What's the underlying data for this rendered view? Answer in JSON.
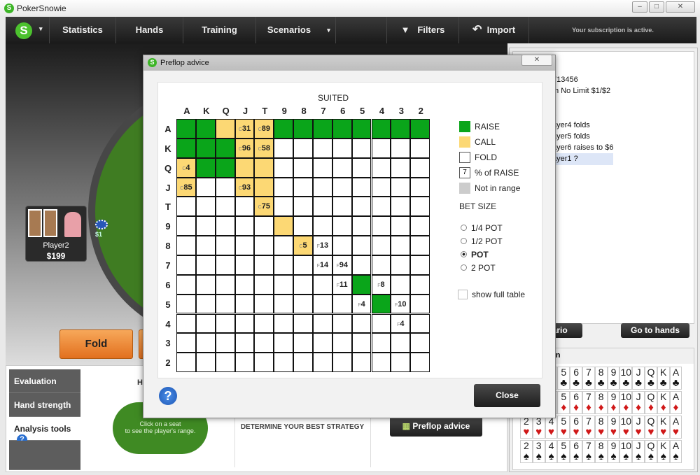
{
  "window": {
    "title": "PokerSnowie",
    "logo": "S"
  },
  "nav": {
    "items": [
      "Statistics",
      "Hands",
      "Training",
      "Scenarios"
    ],
    "filters": "Filters",
    "import": "Import",
    "subscription": "Your subscription is active."
  },
  "table": {
    "player": {
      "name": "Player2",
      "stack": "$199"
    },
    "bet": "$1",
    "fold_label": "Fold"
  },
  "bottom": {
    "tabs": [
      "Evaluation",
      "Hand strength",
      "Analysis tools"
    ],
    "seat_hint_1": "Click on a seat",
    "seat_hint_2": "to see the player's range.",
    "strategy_text": "DETERMINE YOUR BEST STRATEGY",
    "preflop_button": "Preflop advice",
    "hidden_title_fragment": "H"
  },
  "history": {
    "lines": [
      "713456",
      "m No Limit $1/$2",
      "",
      "s",
      "ayer4 folds",
      "ayer5 folds",
      "ayer6 raises to $6",
      "ayer1 ?"
    ],
    "scenario_btn": "nario",
    "goto_btn": "Go to hands",
    "section_title": "on"
  },
  "cards": {
    "ranks": [
      "2",
      "3",
      "4",
      "5",
      "6",
      "7",
      "8",
      "9",
      "10",
      "J",
      "Q",
      "K",
      "A"
    ],
    "suits": [
      {
        "s": "♣",
        "c": "#111"
      },
      {
        "s": "♦",
        "c": "#d01818"
      },
      {
        "s": "♥",
        "c": "#d01818"
      },
      {
        "s": "♠",
        "c": "#111"
      }
    ]
  },
  "dialog": {
    "title": "Preflop advice",
    "suited_label": "SUITED",
    "close": "Close",
    "ranks": [
      "A",
      "K",
      "Q",
      "J",
      "T",
      "9",
      "8",
      "7",
      "6",
      "5",
      "4",
      "3",
      "2"
    ],
    "legend": [
      {
        "label": "RAISE",
        "color": "#0aa51a"
      },
      {
        "label": "CALL",
        "color": "#fcd874"
      },
      {
        "label": "FOLD",
        "color": "#ffffff"
      },
      {
        "label": "% of RAISE",
        "color": "#ffffff",
        "sample": "7"
      },
      {
        "label": "Not in range",
        "color": "#cccccc"
      }
    ],
    "bet_size_label": "BET SIZE",
    "bet_sizes": [
      {
        "label": "1/4 POT",
        "selected": false
      },
      {
        "label": "1/2 POT",
        "selected": false
      },
      {
        "label": "POT",
        "selected": true
      },
      {
        "label": "2 POT",
        "selected": false
      }
    ],
    "show_full_table": {
      "label": "show full table",
      "checked": false
    },
    "grid": [
      [
        "R",
        "R",
        "C",
        "C31",
        "C89",
        "R",
        "R",
        "R",
        "R",
        "R",
        "R",
        "R",
        "R"
      ],
      [
        "R",
        "R",
        "R",
        "C96",
        "C58",
        "F",
        "F",
        "F",
        "F",
        "F",
        "F",
        "F",
        "F"
      ],
      [
        "C4",
        "R",
        "R",
        "C",
        "C",
        "F",
        "F",
        "F",
        "F",
        "F",
        "F",
        "F",
        "F"
      ],
      [
        "C85",
        "F",
        "F",
        "C93",
        "C",
        "F",
        "F",
        "F",
        "F",
        "F",
        "F",
        "F",
        "F"
      ],
      [
        "F",
        "F",
        "F",
        "F",
        "C75",
        "F",
        "F",
        "F",
        "F",
        "F",
        "F",
        "F",
        "F"
      ],
      [
        "F",
        "F",
        "F",
        "F",
        "F",
        "C",
        "F",
        "F",
        "F",
        "F",
        "F",
        "F",
        "F"
      ],
      [
        "F",
        "F",
        "F",
        "F",
        "F",
        "F",
        "C5",
        "F13",
        "F",
        "F",
        "F",
        "F",
        "F"
      ],
      [
        "F",
        "F",
        "F",
        "F",
        "F",
        "F",
        "F",
        "F14",
        "F94",
        "F",
        "F",
        "F",
        "F"
      ],
      [
        "F",
        "F",
        "F",
        "F",
        "F",
        "F",
        "F",
        "F",
        "F11",
        "R",
        "F8",
        "F",
        "F"
      ],
      [
        "F",
        "F",
        "F",
        "F",
        "F",
        "F",
        "F",
        "F",
        "F",
        "F4",
        "R",
        "F10",
        "F"
      ],
      [
        "F",
        "F",
        "F",
        "F",
        "F",
        "F",
        "F",
        "F",
        "F",
        "F",
        "F",
        "F4",
        "F"
      ],
      [
        "F",
        "F",
        "F",
        "F",
        "F",
        "F",
        "F",
        "F",
        "F",
        "F",
        "F",
        "F",
        "F"
      ],
      [
        "F",
        "F",
        "F",
        "F",
        "F",
        "F",
        "F",
        "F",
        "F",
        "F",
        "F",
        "F",
        "F"
      ]
    ]
  }
}
